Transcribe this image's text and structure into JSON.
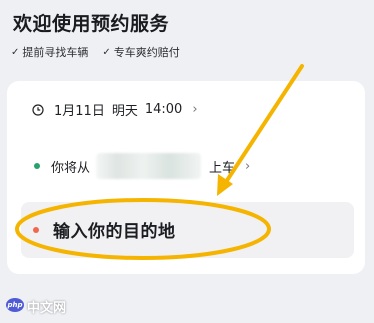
{
  "header": {
    "title": "欢迎使用预约服务",
    "features": [
      "提前寻找车辆",
      "专车爽约赔付"
    ]
  },
  "card": {
    "time": {
      "date": "1月11日",
      "weekday": "明天",
      "clock": "14:00"
    },
    "pickup": {
      "prefix": "你将从",
      "suffix": "上车"
    },
    "destination": {
      "placeholder": "输入你的目的地"
    }
  },
  "watermark": {
    "logo": "php",
    "text": "中文网"
  },
  "colors": {
    "annotation": "#f5b400",
    "pickup_dot": "#26a26a",
    "destination_dot": "#f2674b"
  }
}
